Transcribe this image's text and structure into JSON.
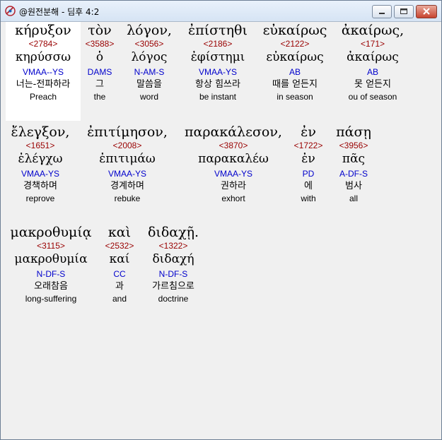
{
  "window": {
    "title": "@원전분해 - 딤후 4:2"
  },
  "verse": [
    {
      "greek": "κήρυξον",
      "strong": "<2784>",
      "lemma": "κηρύσσω",
      "parse": "VMAA--YS",
      "korean": "너는-전파하라",
      "english": "Preach",
      "selected": true
    },
    {
      "greek": "τὸν",
      "strong": "<3588>",
      "lemma": "ὁ",
      "parse": "DAMS",
      "korean": "그",
      "english": "the"
    },
    {
      "greek": "λόγον,",
      "strong": "<3056>",
      "lemma": "λόγος",
      "parse": "N-AM-S",
      "korean": "말씀을",
      "english": "word"
    },
    {
      "greek": "ἐπίστηθι",
      "strong": "<2186>",
      "lemma": "ἐφίστημι",
      "parse": "VMAA-YS",
      "korean": "항상 힘쓰라",
      "english": "be instant"
    },
    {
      "greek": "εὐκαίρως",
      "strong": "<2122>",
      "lemma": "εὐκαίρως",
      "parse": "AB",
      "korean": "때를 얻든지",
      "english": "in season"
    },
    {
      "greek": "ἀκαίρως,",
      "strong": "<171>",
      "lemma": "ἀκαίρως",
      "parse": "AB",
      "korean": "못 얻든지",
      "english": "ou of season"
    },
    {
      "greek": "ἔλεγξον,",
      "strong": "<1651>",
      "lemma": "ἐλέγχω",
      "parse": "VMAA-YS",
      "korean": "경책하며",
      "english": "reprove"
    },
    {
      "greek": "ἐπιτίμησον,",
      "strong": "<2008>",
      "lemma": "ἐπιτιμάω",
      "parse": "VMAA-YS",
      "korean": "경계하며",
      "english": "rebuke"
    },
    {
      "greek": "παρακάλεσον,",
      "strong": "<3870>",
      "lemma": "παρακαλέω",
      "parse": "VMAA-YS",
      "korean": "권하라",
      "english": "exhort"
    },
    {
      "greek": "ἐν",
      "strong": "<1722>",
      "lemma": "ἐν",
      "parse": "PD",
      "korean": "에",
      "english": "with"
    },
    {
      "greek": "πάσῃ",
      "strong": "<3956>",
      "lemma": "πᾶς",
      "parse": "A-DF-S",
      "korean": "범사",
      "english": "all"
    },
    {
      "greek": "μακροθυμίᾳ",
      "strong": "<3115>",
      "lemma": "μακροθυμία",
      "parse": "N-DF-S",
      "korean": "오래참음",
      "english": "long-suffering"
    },
    {
      "greek": "καὶ",
      "strong": "<2532>",
      "lemma": "καί",
      "parse": "CC",
      "korean": "과",
      "english": "and"
    },
    {
      "greek": "διδαχῇ.",
      "strong": "<1322>",
      "lemma": "διδαχή",
      "parse": "N-DF-S",
      "korean": "가르침으로",
      "english": "doctrine"
    }
  ]
}
